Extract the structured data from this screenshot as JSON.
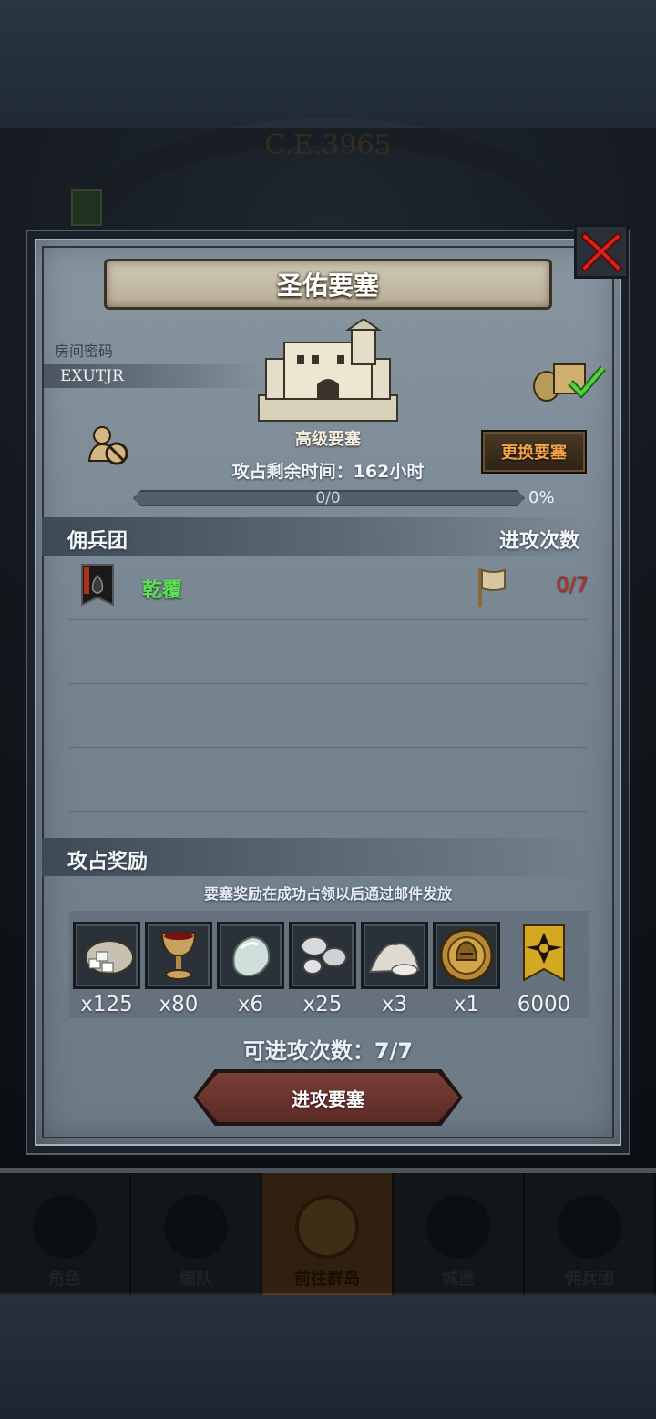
{
  "background": {
    "year_label": "C.E.3965"
  },
  "bottom_nav": {
    "tabs": [
      {
        "label": "角色",
        "active": false
      },
      {
        "label": "编队",
        "active": false
      },
      {
        "label": "前往群岛",
        "active": true
      },
      {
        "label": "城堡",
        "active": false
      },
      {
        "label": "佣兵团",
        "active": false
      }
    ]
  },
  "dialog": {
    "title": "圣佑要塞",
    "room_password_label": "房间密码",
    "room_password": "EXUTJR",
    "fortress_level": "高级要塞",
    "change_fortress_button": "更换要塞",
    "remaining_time": "攻占剩余时间：162小时",
    "progress": {
      "text": "0/0",
      "percent_label": "0%",
      "fraction": 0
    },
    "mercenary_section": {
      "title": "佣兵团",
      "right_header": "进攻次数",
      "rows": [
        {
          "name": "乾覆",
          "attacks": "0/7"
        }
      ]
    },
    "reward_section": {
      "title": "攻占奖励",
      "note": "要塞奖励在成功占领以后通过邮件发放",
      "items": [
        {
          "icon": "ore-sack-icon",
          "qty": "x125"
        },
        {
          "icon": "goblet-icon",
          "qty": "x80"
        },
        {
          "icon": "gem-stone-icon",
          "qty": "x6"
        },
        {
          "icon": "silver-ore-icon",
          "qty": "x25"
        },
        {
          "icon": "powder-pile-icon",
          "qty": "x3"
        },
        {
          "icon": "helmet-medal-icon",
          "qty": "x1"
        },
        {
          "icon": "honor-banner-icon",
          "qty": "6000"
        }
      ]
    },
    "attacks_available": "可进攻次数：7/7",
    "attack_button": "进攻要塞"
  },
  "colors": {
    "merc_name": "#5fe05a",
    "attack_count": "#c22c25",
    "change_button_text": "#f3a44a"
  }
}
